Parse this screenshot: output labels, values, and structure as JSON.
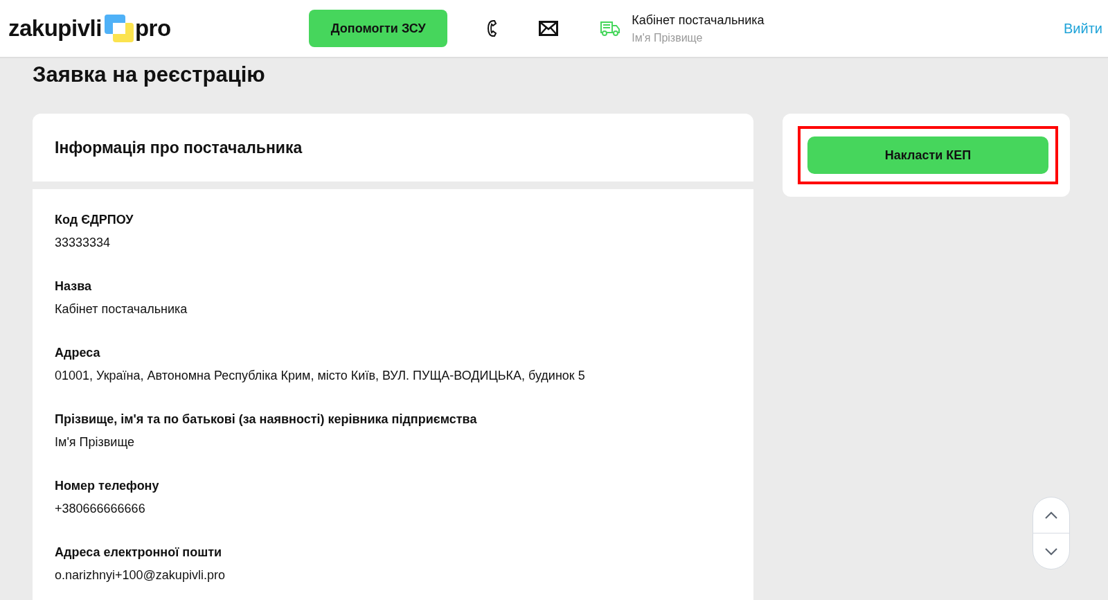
{
  "header": {
    "logo_left": "zakupivli",
    "logo_right": "pro",
    "donate_button": "Допомогти ЗСУ",
    "account_title": "Кабінет постачальника",
    "account_user": "Ім'я Прізвище",
    "logout": "Вийти"
  },
  "page_title": "Заявка на реєстрацію",
  "section_title": "Інформація про постачальника",
  "fields": [
    {
      "label": "Код ЄДРПОУ",
      "value": "33333334"
    },
    {
      "label": "Назва",
      "value": "Кабінет постачальника"
    },
    {
      "label": "Адреса",
      "value": "01001, Україна, Автономна Республіка Крим, місто Київ, ВУЛ. ПУЩА-ВОДИЦЬКА, будинок 5"
    },
    {
      "label": "Прізвище, ім'я та по батькові (за наявності) керівника підприємства",
      "value": "Ім'я Прізвище"
    },
    {
      "label": "Номер телефону",
      "value": "+380666666666"
    },
    {
      "label": "Адреса електронної пошти",
      "value": "o.narizhnyi+100@zakupivli.pro"
    }
  ],
  "sign_button": {
    "label": "Накласти КЕП",
    "highlighted": true
  }
}
